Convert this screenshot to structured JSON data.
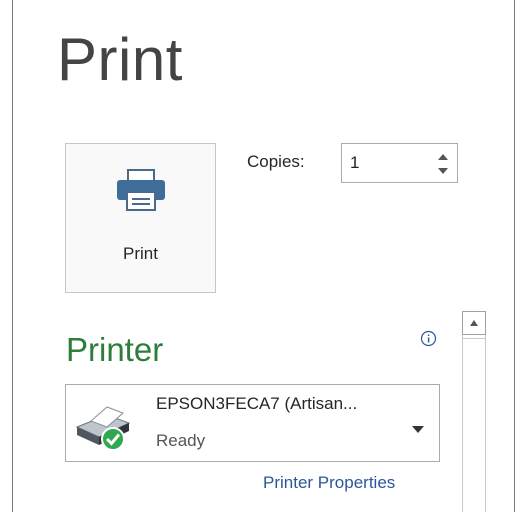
{
  "title": "Print",
  "print_button": {
    "label": "Print",
    "icon": "printer-icon"
  },
  "copies": {
    "label": "Copies:",
    "value": "1"
  },
  "printer_section": {
    "title": "Printer",
    "info_icon": "info-icon",
    "selected_printer": {
      "name": "EPSON3FECA7 (Artisan...",
      "status": "Ready",
      "icon": "printer-ready-icon"
    },
    "properties_link": "Printer Properties"
  },
  "colors": {
    "accent_green": "#2e7d3c",
    "link_blue": "#2b579a",
    "text": "#262626"
  }
}
